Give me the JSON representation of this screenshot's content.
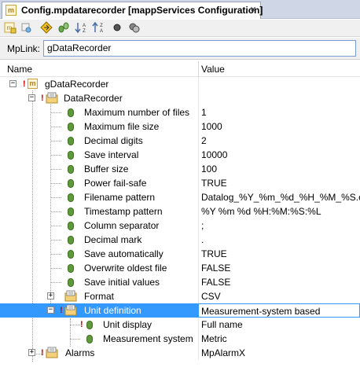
{
  "tab": {
    "title": "Config.mpdatarecorder [mappServices Configuration]",
    "close": "×"
  },
  "toolbar": {
    "icons": [
      "config-icon",
      "properties-icon",
      "navigate-icon",
      "link-icon",
      "sort-descending-icon",
      "sort-ascending-icon",
      "record-icon",
      "refresh-icon"
    ]
  },
  "mplink": {
    "label": "MpLink:",
    "value": "gDataRecorder"
  },
  "columns": {
    "name": "Name",
    "value": "Value"
  },
  "tree": {
    "root": "gDataRecorder",
    "group": "DataRecorder",
    "params": [
      {
        "name": "Maximum number of files",
        "value": "1"
      },
      {
        "name": "Maximum file size",
        "value": "1000"
      },
      {
        "name": "Decimal digits",
        "value": "2"
      },
      {
        "name": "Save interval",
        "value": "10000"
      },
      {
        "name": "Buffer size",
        "value": "100"
      },
      {
        "name": "Power fail-safe",
        "value": "TRUE"
      },
      {
        "name": "Filename pattern",
        "value": "Datalog_%Y_%m_%d_%H_%M_%S.csv"
      },
      {
        "name": "Timestamp pattern",
        "value": "%Y %m %d %H:%M:%S:%L"
      },
      {
        "name": "Column separator",
        "value": ";"
      },
      {
        "name": "Decimal mark",
        "value": "."
      },
      {
        "name": "Save automatically",
        "value": "TRUE"
      },
      {
        "name": "Overwrite oldest file",
        "value": "FALSE"
      },
      {
        "name": "Save initial values",
        "value": "FALSE"
      }
    ],
    "format": {
      "name": "Format",
      "value": "CSV"
    },
    "unit_definition": {
      "name": "Unit definition",
      "value": "Measurement-system based"
    },
    "unit_children": [
      {
        "name": "Unit display",
        "value": "Full name"
      },
      {
        "name": "Measurement system",
        "value": "Metric"
      }
    ],
    "alarms": {
      "name": "Alarms",
      "value": "MpAlarmX"
    }
  },
  "colors": {
    "selection": "#3399ff",
    "param_icon": "#5e9a39",
    "tab_bar": "#cfd6e5"
  }
}
